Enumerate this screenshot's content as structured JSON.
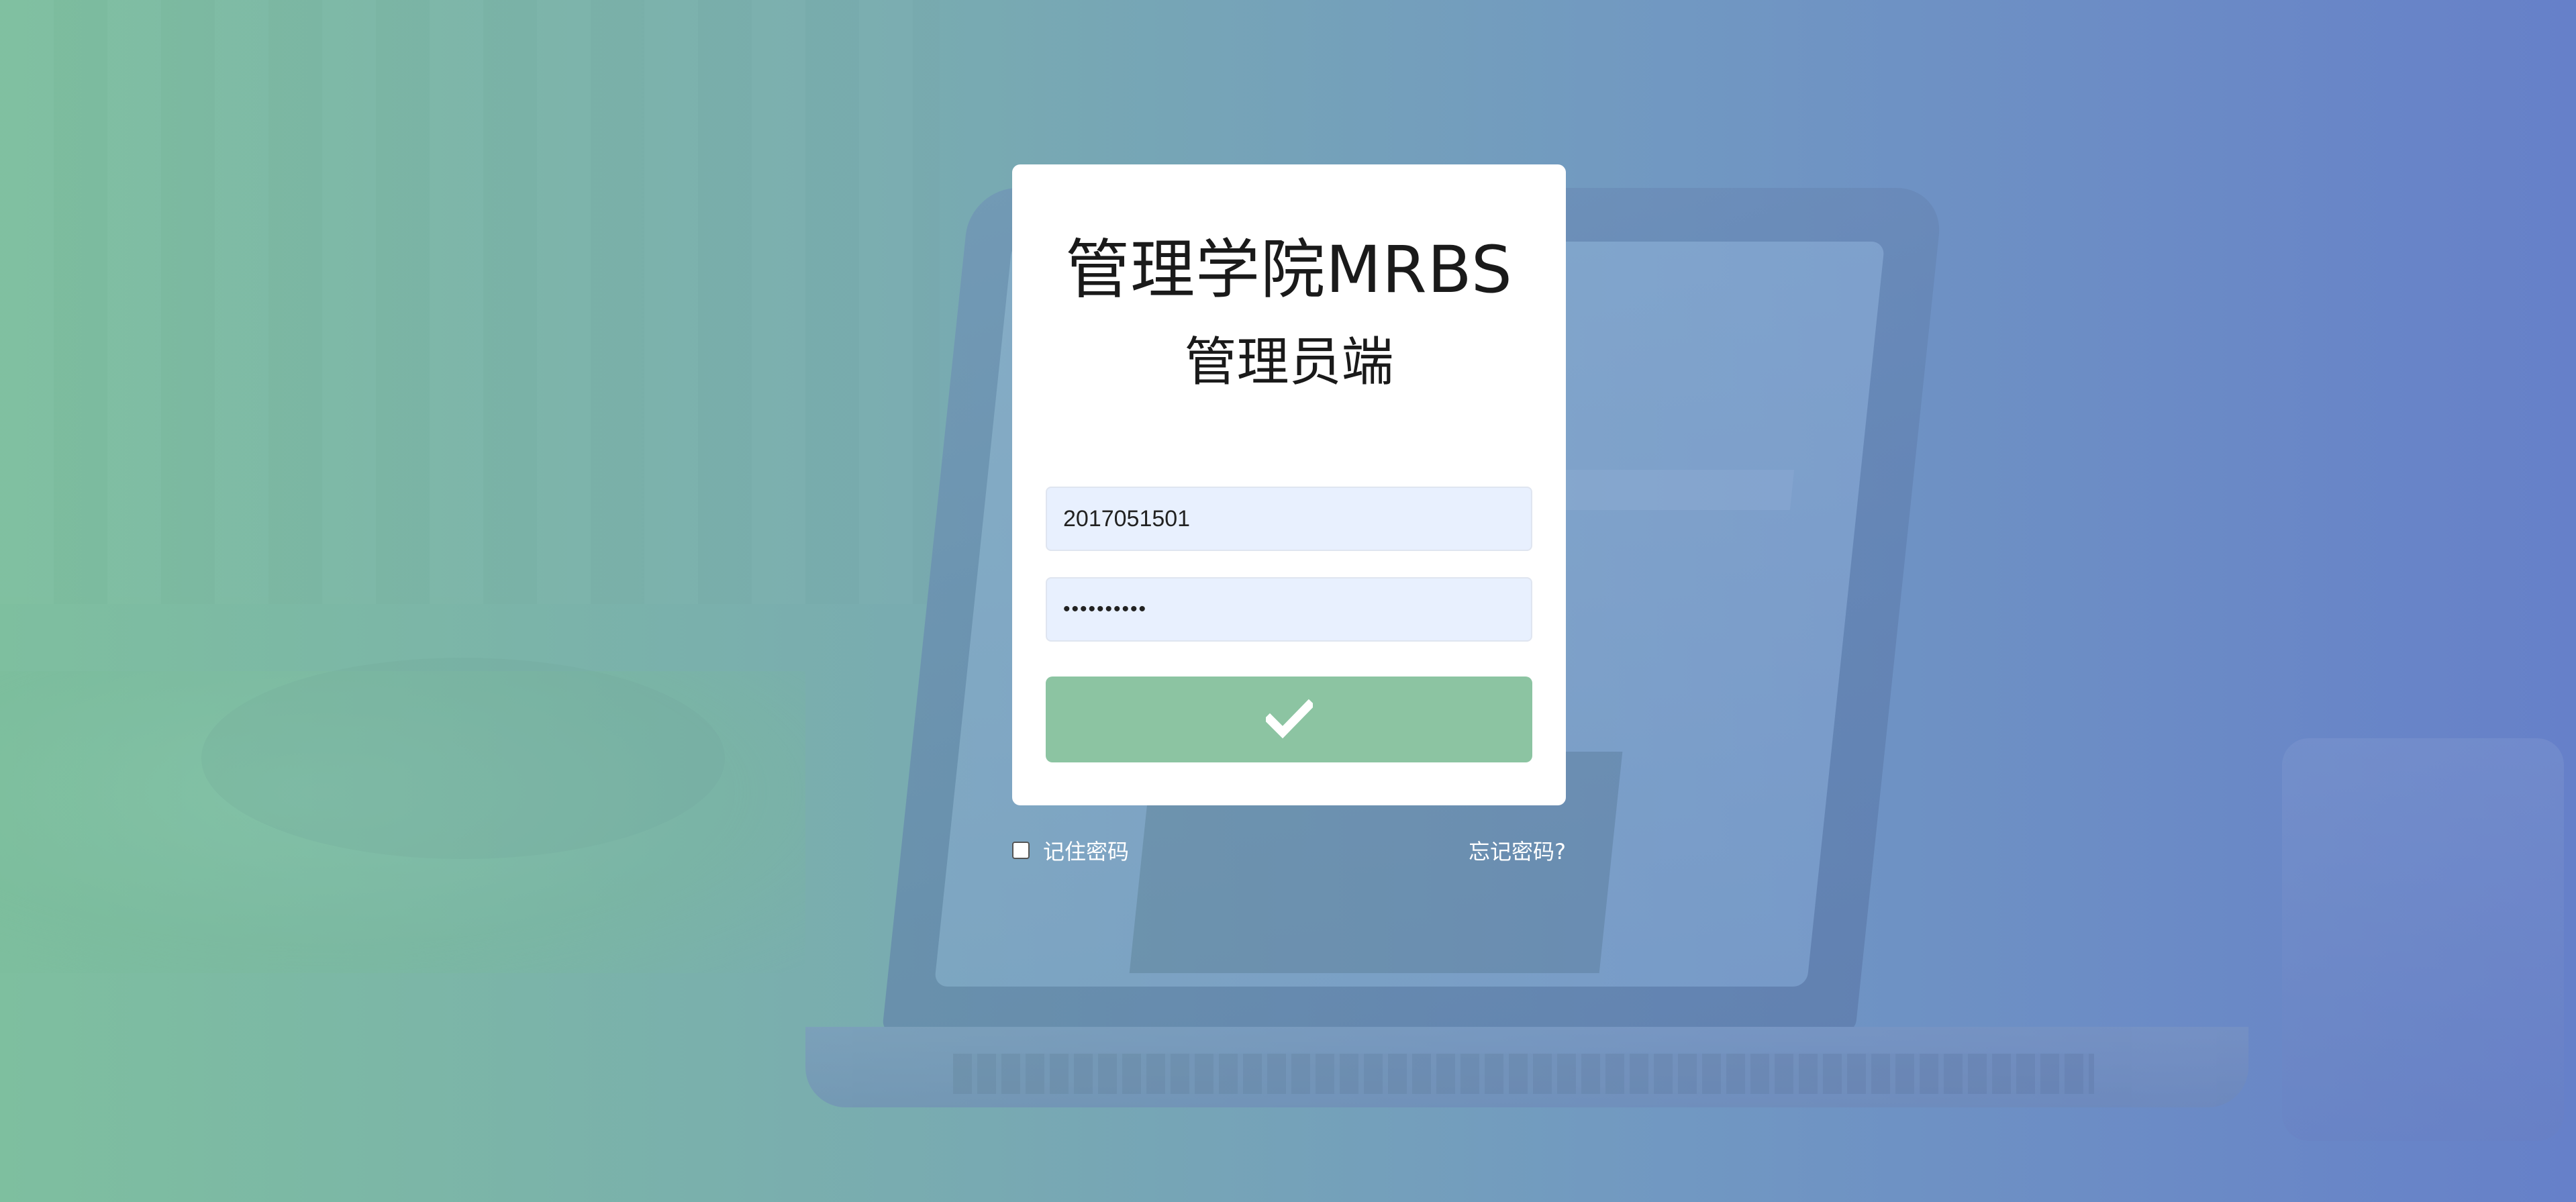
{
  "login": {
    "title": "管理学院MRBS",
    "subtitle": "管理员端",
    "username_value": "2017051501",
    "password_value": "••••••••••",
    "submit_icon": "check-icon",
    "remember_label": "记住密码",
    "forgot_label": "忘记密码?"
  },
  "colors": {
    "gradient_left": "#7ebf9f",
    "gradient_right": "#6680c9",
    "card_bg": "#ffffff",
    "input_bg": "#e8f0fe",
    "button_bg": "#8cc4a2"
  }
}
